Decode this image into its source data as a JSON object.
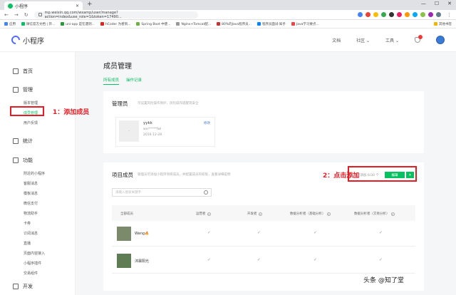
{
  "browser": {
    "tab_title": "小程序",
    "url": "mp.weixin.qq.com/wxamp/user/manage?action=index&use_role=1&token=17490...",
    "bookmarks": [
      "应用",
      "微信官方文档 | 开...",
      "uni-app 是在遇到...",
      "hCoder 为者到...",
      "Spring Boot 中使...",
      "Nginx+Tomcat配...",
      "80%的Java程序员...",
      "程序员面试·知乎",
      "Java学习要点..."
    ],
    "bookmarks_right": [
      "其他书签"
    ]
  },
  "header": {
    "logo_text": "小程序",
    "nav": [
      "文档",
      "社区",
      "工具"
    ]
  },
  "sidebar": {
    "home": "首页",
    "manage": "管理",
    "manage_items": [
      "版本管理",
      "成员管理",
      "用户反馈"
    ],
    "stats": "统计",
    "functions": "功能",
    "function_items": [
      "附近的小程序",
      "客服消息",
      "模板消息",
      "微信支付",
      "物流助手",
      "卡券",
      "订阅消息",
      "直播",
      "页面内容接入",
      "小程序插件",
      "交易组件"
    ],
    "dev": "开发"
  },
  "page": {
    "title": "成员管理",
    "tabs": [
      "所有成员",
      "操作记录"
    ]
  },
  "admin_card": {
    "title": "管理员",
    "hint": "可设置风险操作保护、风险操作提醒等安全",
    "name": "yykk",
    "account": "wxi*****fwl",
    "date": "2016-12-28",
    "edit": "修改"
  },
  "members_card": {
    "title": "项目成员",
    "hint": "管理员可添加小程序项目成员，并配置成员的权限，查看详细说明",
    "count": "已添加 6/30 个",
    "edit_button": "编辑",
    "dropdown": "▾",
    "search_placeholder": "请输入搜索关键字",
    "columns": [
      "全部成员",
      "运营者",
      "开发者",
      "数据分析者（基础分析）",
      "数据分析者（交易分析）"
    ],
    "rows": [
      {
        "name": "Wang🔥",
        "checks": [
          "✓",
          "✓",
          "✓",
          "✓"
        ]
      },
      {
        "name": "沐霖阳光",
        "checks": [
          "✓",
          "✓",
          "✓",
          "✓"
        ]
      }
    ]
  },
  "annotations": {
    "step1": "1：添加成员",
    "step2": "2：点击添加"
  },
  "watermark": "头条 @知了堂"
}
